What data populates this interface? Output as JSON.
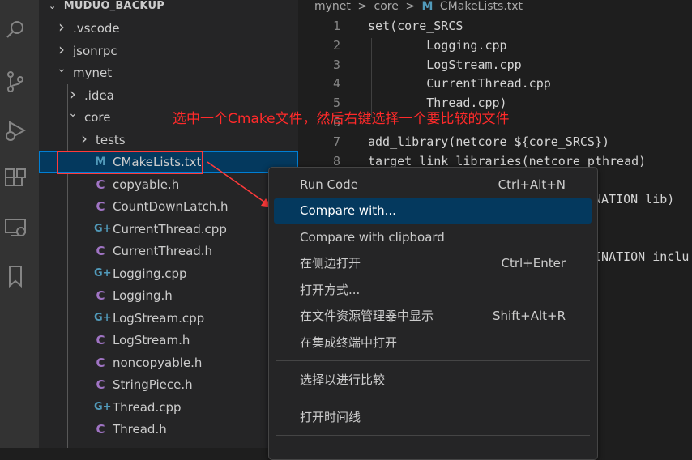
{
  "explorer": {
    "title": "MUDUO_BACKUP",
    "items": [
      {
        "label": ".vscode",
        "type": "folder",
        "state": "collapsed"
      },
      {
        "label": "jsonrpc",
        "type": "folder",
        "state": "collapsed"
      },
      {
        "label": "mynet",
        "type": "folder",
        "state": "expanded"
      },
      {
        "label": ".idea",
        "type": "folder",
        "state": "collapsed"
      },
      {
        "label": "core",
        "type": "folder",
        "state": "expanded"
      },
      {
        "label": "tests",
        "type": "folder",
        "state": "collapsed"
      },
      {
        "label": "CMakeLists.txt",
        "type": "cmake",
        "icon": "M",
        "selected": true
      },
      {
        "label": "copyable.h",
        "type": "h",
        "icon": "C"
      },
      {
        "label": "CountDownLatch.h",
        "type": "h",
        "icon": "C"
      },
      {
        "label": "CurrentThread.cpp",
        "type": "cpp",
        "icon": "G+"
      },
      {
        "label": "CurrentThread.h",
        "type": "h",
        "icon": "C"
      },
      {
        "label": "Logging.cpp",
        "type": "cpp",
        "icon": "G+"
      },
      {
        "label": "Logging.h",
        "type": "h",
        "icon": "C"
      },
      {
        "label": "LogStream.cpp",
        "type": "cpp",
        "icon": "G+"
      },
      {
        "label": "LogStream.h",
        "type": "h",
        "icon": "C"
      },
      {
        "label": "noncopyable.h",
        "type": "h",
        "icon": "C"
      },
      {
        "label": "StringPiece.h",
        "type": "h",
        "icon": "C"
      },
      {
        "label": "Thread.cpp",
        "type": "cpp",
        "icon": "G+"
      },
      {
        "label": "Thread.h",
        "type": "h",
        "icon": "C"
      }
    ]
  },
  "breadcrumb": {
    "parts": [
      "mynet",
      "core",
      "CMakeLists.txt"
    ],
    "separator": ">",
    "file_icon": "M"
  },
  "editor": {
    "line_numbers": [
      "1",
      "2",
      "3",
      "4",
      "5",
      "6",
      "7",
      "8"
    ],
    "lines": [
      "set(core_SRCS",
      "        Logging.cpp",
      "        LogStream.cpp",
      "        CurrentThread.cpp",
      "        Thread.cpp)",
      "",
      "add_library(netcore ${core_SRCS})",
      "target_link_libraries(netcore pthread)"
    ],
    "partial_lines": [
      "NATION lib)",
      "INATION inclu"
    ]
  },
  "annotation": {
    "text": "选中一个Cmake文件，然后右键选择一个要比较的文件",
    "color": "#ff2a2a"
  },
  "context_menu": {
    "items": [
      {
        "label": "Run Code",
        "shortcut": "Ctrl+Alt+N"
      },
      {
        "label": "Compare with...",
        "shortcut": "",
        "active": true
      },
      {
        "label": "Compare with clipboard",
        "shortcut": ""
      },
      {
        "label": "在侧边打开",
        "shortcut": "Ctrl+Enter"
      },
      {
        "label": "打开方式...",
        "shortcut": ""
      },
      {
        "label": "在文件资源管理器中显示",
        "shortcut": "Shift+Alt+R"
      },
      {
        "label": "在集成终端中打开",
        "shortcut": ""
      },
      {
        "label": "选择以进行比较",
        "shortcut": ""
      },
      {
        "label": "打开时间线",
        "shortcut": ""
      }
    ]
  },
  "activity_bar": {
    "icons": [
      "search-icon",
      "source-control-icon",
      "run-debug-icon",
      "extensions-icon",
      "remote-explorer-icon",
      "bookmark-icon"
    ]
  },
  "colors": {
    "selection": "#04395e",
    "annotation": "#ff2a2a",
    "header_icon_c": "#a074c4",
    "header_icon_cpp": "#519aba"
  }
}
